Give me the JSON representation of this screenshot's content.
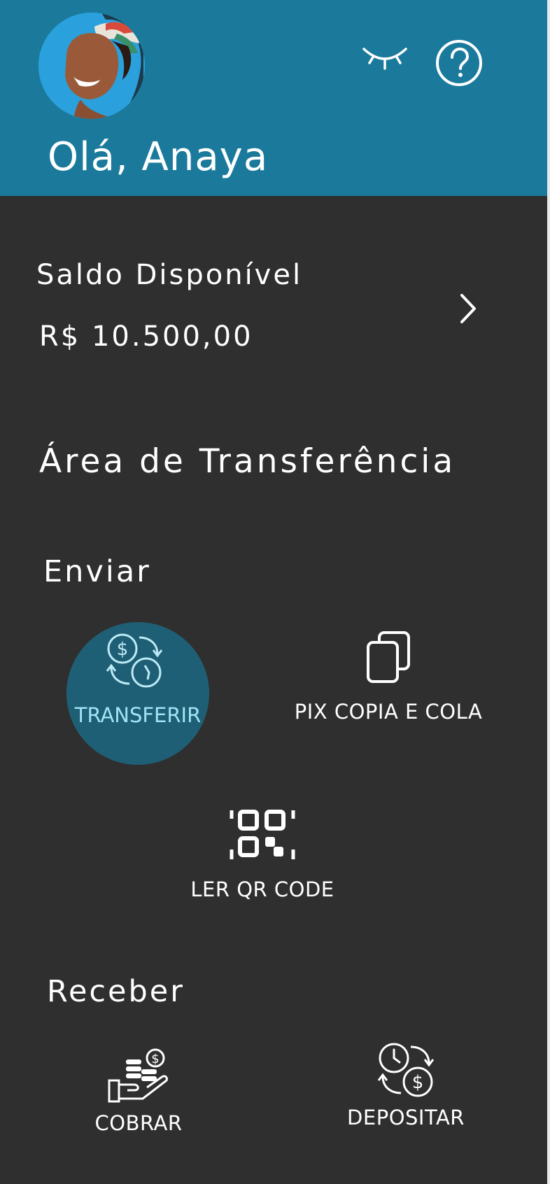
{
  "header": {
    "greeting": "Olá, Anaya",
    "background_color": "#1b7a9c",
    "icons": [
      "avatar",
      "eye-closed-icon",
      "help-icon"
    ]
  },
  "balance": {
    "label": "Saldo Disponível",
    "value": "R$ 10.500,00"
  },
  "transfer_area": {
    "title": "Área de Transferência",
    "send": {
      "title": "Enviar",
      "actions": [
        {
          "label": "TRANSFERIR",
          "icon": "money-exchange-icon",
          "selected": true,
          "highlight_color": "#1f5f75"
        },
        {
          "label": "PIX COPIA E COLA",
          "icon": "copy-icon",
          "selected": false
        },
        {
          "label": "LER QR CODE",
          "icon": "qr-code-scan-icon",
          "selected": false
        }
      ]
    },
    "receive": {
      "title": "Receber",
      "actions": [
        {
          "label": "COBRAR",
          "icon": "hand-coins-icon"
        },
        {
          "label": "DEPOSITAR",
          "icon": "clock-money-icon"
        }
      ]
    }
  }
}
